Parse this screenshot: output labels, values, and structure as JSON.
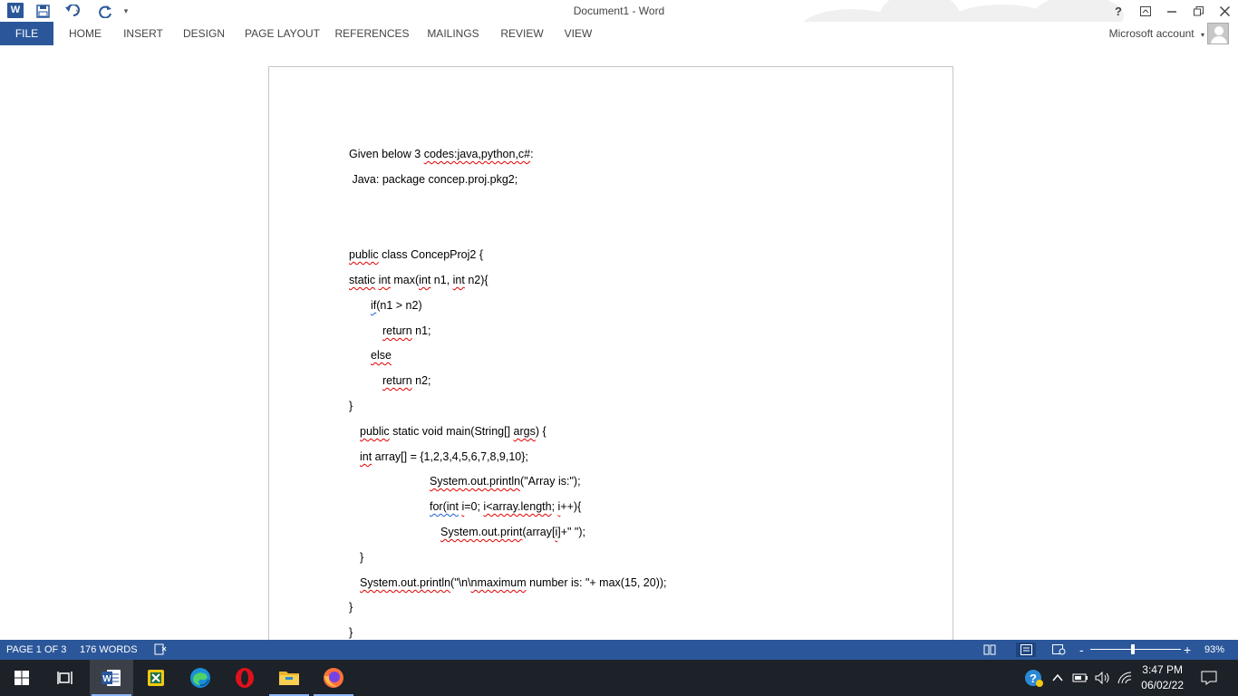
{
  "window": {
    "title": "Document1 - Word",
    "help": "?",
    "account_label": "Microsoft account"
  },
  "quick_access": [
    "word-icon",
    "save-icon",
    "undo-icon",
    "redo-icon",
    "customize-icon"
  ],
  "tabs": [
    "FILE",
    "HOME",
    "INSERT",
    "DESIGN",
    "PAGE LAYOUT",
    "REFERENCES",
    "MAILINGS",
    "REVIEW",
    "VIEW"
  ],
  "document": {
    "lines": [
      "Given below 3 codes:java,python,c#:",
      " Java: package concep.proj.pkg2;",
      "public class ConcepProj2 {",
      "static int max(int n1, int n2){",
      "if(n1 > n2)",
      "return n1;",
      "else",
      "return n2;",
      "}",
      "public static void main(String[] args) {",
      "int array[] = {1,2,3,4,5,6,7,8,9,10};",
      "System.out.println(\"Array is:\");",
      "for(int i=0; i<array.length; i++){",
      "System.out.print(array[i]+\" \");",
      "}",
      "System.out.println(\"\\n\\nmaximum number is: \"+ max(15, 20));",
      "}",
      "}"
    ]
  },
  "status": {
    "page": "PAGE 1 OF 3",
    "words": "176 WORDS",
    "zoom": "93%",
    "zoom_minus": "-",
    "zoom_plus": "+",
    "zoom_level_percent": 93
  },
  "taskbar": {
    "time": "3:47 PM",
    "date": "06/02/22",
    "apps": [
      "windows-start-icon",
      "task-view-icon",
      "word-app-icon",
      "excel-app-icon",
      "edge-app-icon",
      "opera-app-icon",
      "file-explorer-icon",
      "firefox-app-icon"
    ]
  },
  "colors": {
    "accent": "#2b579a",
    "taskbar": "#1d2128",
    "spell_error": "#e00000",
    "grammar": "#2060d0"
  }
}
